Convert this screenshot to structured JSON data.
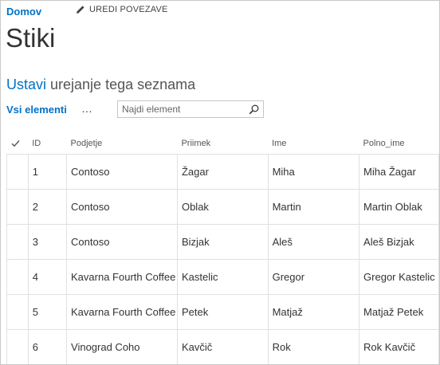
{
  "nav": {
    "home": "Domov",
    "edit_links": "UREDI POVEZAVE"
  },
  "page": {
    "title": "Stiki"
  },
  "edit_list": {
    "action": "Ustavi",
    "rest": " urejanje tega seznama"
  },
  "toolbar": {
    "view": "Vsi elementi",
    "more": "…",
    "search_placeholder": "Najdi element"
  },
  "table": {
    "columns": [
      "ID",
      "Podjetje",
      "Priimek",
      "Ime",
      "Polno_ime"
    ],
    "rows": [
      [
        "1",
        "Contoso",
        "Žagar",
        "Miha",
        "Miha Žagar"
      ],
      [
        "2",
        "Contoso",
        "Oblak",
        "Martin",
        "Martin Oblak"
      ],
      [
        "3",
        "Contoso",
        "Bizjak",
        "Aleš",
        "Aleš Bizjak"
      ],
      [
        "4",
        "Kavarna Fourth Coffee",
        "Kastelic",
        "Gregor",
        "Gregor Kastelic"
      ],
      [
        "5",
        "Kavarna Fourth Coffee",
        "Petek",
        "Matjaž",
        "Matjaž Petek"
      ],
      [
        "6",
        "Vinograd Coho",
        "Kavčič",
        "Rok",
        "Rok Kavčič"
      ]
    ]
  },
  "icons": {
    "edit": "pencil-icon",
    "search": "search-icon",
    "select": "checkmark-icon"
  },
  "colors": {
    "accent": "#0072c6",
    "text": "#333333",
    "border": "#e1e1e1"
  }
}
